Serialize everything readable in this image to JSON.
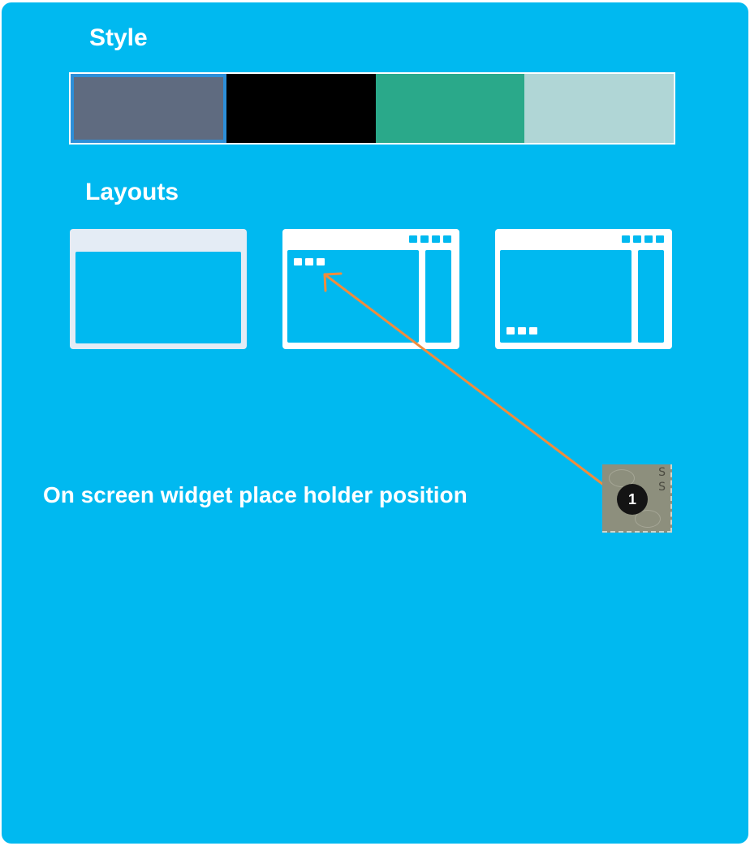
{
  "style": {
    "title": "Style",
    "swatches": [
      {
        "name": "slate",
        "color": "#5f6b80",
        "selected": true
      },
      {
        "name": "black",
        "color": "#000000",
        "selected": false
      },
      {
        "name": "green",
        "color": "#2aa98a",
        "selected": false
      },
      {
        "name": "mint",
        "color": "#b0d6d6",
        "selected": false
      }
    ],
    "selection_color": "#2d8fd8"
  },
  "layouts": {
    "title": "Layouts"
  },
  "annotation": {
    "caption": "On screen widget place holder position",
    "arrow_color": "#f08c3c",
    "badge_number": "1",
    "chip_letters": [
      "S",
      "S"
    ]
  },
  "colors": {
    "panel_background": "#00b9f0",
    "text": "#ffffff"
  }
}
